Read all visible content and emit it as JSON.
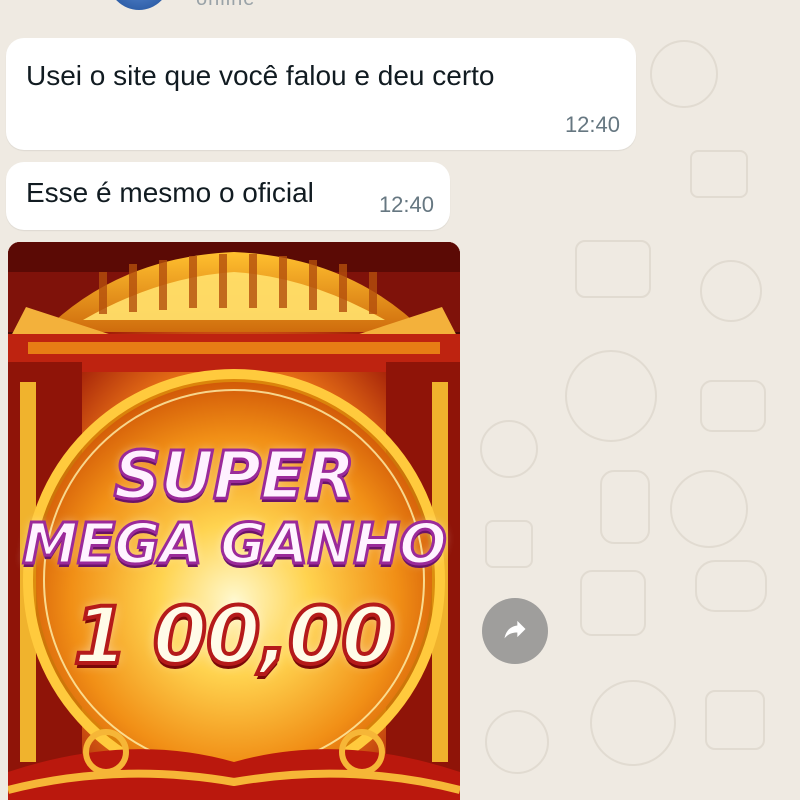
{
  "header": {
    "status_text": "online"
  },
  "messages": [
    {
      "text": "Usei o site que você falou e deu certo",
      "time": "12:40"
    },
    {
      "text": "Esse é mesmo o oficial",
      "time": "12:40"
    }
  ],
  "image_message": {
    "title_line_1": "SUPER",
    "title_line_2": "MEGA GANHO",
    "amount": "1 00,00"
  },
  "icons": {
    "forward": "forward-icon",
    "avatar": "avatar"
  },
  "colors": {
    "chat_background": "#efeae2",
    "bubble_background": "#ffffff",
    "timestamp": "#667781",
    "forward_button": "#888888",
    "image_frame": "#6a0f0a"
  }
}
